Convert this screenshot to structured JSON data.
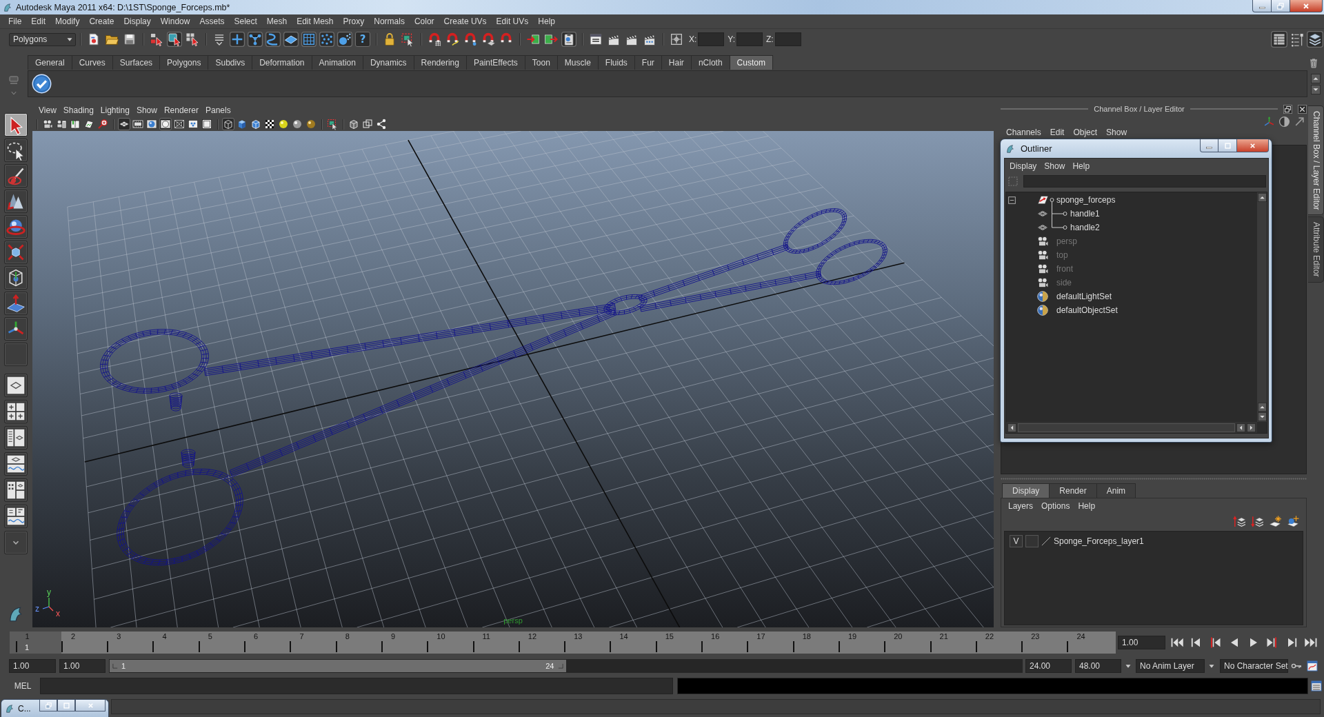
{
  "window": {
    "title": "Autodesk Maya 2011 x64: D:\\1ST\\Sponge_Forceps.mb*"
  },
  "menu_bar": [
    "File",
    "Edit",
    "Modify",
    "Create",
    "Display",
    "Window",
    "Assets",
    "Select",
    "Mesh",
    "Edit Mesh",
    "Proxy",
    "Normals",
    "Color",
    "Create UVs",
    "Edit UVs",
    "Help"
  ],
  "status_line": {
    "menu_set": "Polygons",
    "tool_groups": [
      [
        {
          "kind": "new",
          "on": false
        },
        {
          "kind": "open",
          "on": false
        },
        {
          "kind": "save",
          "on": false
        }
      ],
      [
        {
          "kind": "hierarchy",
          "on": false
        },
        {
          "kind": "object",
          "on": true
        },
        {
          "kind": "component",
          "on": false
        }
      ],
      [
        {
          "kind": "masks",
          "on": false
        },
        {
          "kind": "handles",
          "on": true
        },
        {
          "kind": "joints",
          "on": true
        },
        {
          "kind": "curves",
          "on": true
        },
        {
          "kind": "surfaces",
          "on": true
        },
        {
          "kind": "deformers",
          "on": true
        },
        {
          "kind": "dynamics",
          "on": true
        },
        {
          "kind": "rendering",
          "on": true
        },
        {
          "kind": "help",
          "label": "?",
          "on": true
        }
      ],
      [
        {
          "kind": "lock",
          "on": false
        },
        {
          "kind": "highlight",
          "on": false
        }
      ],
      [
        {
          "kind": "snapgrid",
          "on": false
        },
        {
          "kind": "snapcurve",
          "on": false
        },
        {
          "kind": "snappoint",
          "on": false
        },
        {
          "kind": "snapplane",
          "on": false
        },
        {
          "kind": "snaplive",
          "on": false
        }
      ],
      [
        {
          "kind": "inputs",
          "on": false
        },
        {
          "kind": "outputs",
          "on": false
        },
        {
          "kind": "history",
          "on": true
        }
      ],
      [
        {
          "kind": "renderview",
          "on": false
        },
        {
          "kind": "render",
          "on": false
        },
        {
          "kind": "ipr",
          "on": false
        },
        {
          "kind": "rendersettings",
          "on": false
        }
      ]
    ],
    "coordinate_labels": [
      "X:",
      "Y:",
      "Z:"
    ],
    "panel_toggles": [
      {
        "kind": "attributes",
        "on": true
      },
      {
        "kind": "toolsettings",
        "on": false
      },
      {
        "kind": "channels",
        "on": true
      }
    ]
  },
  "shelf": {
    "tabs": [
      {
        "label": "General",
        "selected": false
      },
      {
        "label": "Curves",
        "selected": false
      },
      {
        "label": "Surfaces",
        "selected": false
      },
      {
        "label": "Polygons",
        "selected": false
      },
      {
        "label": "Subdivs",
        "selected": false
      },
      {
        "label": "Deformation",
        "selected": false
      },
      {
        "label": "Animation",
        "selected": false
      },
      {
        "label": "Dynamics",
        "selected": false
      },
      {
        "label": "Rendering",
        "selected": false
      },
      {
        "label": "PaintEffects",
        "selected": false
      },
      {
        "label": "Toon",
        "selected": false
      },
      {
        "label": "Muscle",
        "selected": false
      },
      {
        "label": "Fluids",
        "selected": false
      },
      {
        "label": "Fur",
        "selected": false
      },
      {
        "label": "Hair",
        "selected": false
      },
      {
        "label": "nCloth",
        "selected": false
      },
      {
        "label": "Custom",
        "selected": true
      }
    ]
  },
  "toolbox": {
    "tools": [
      {
        "kind": "select",
        "selected": true
      },
      {
        "kind": "lasso",
        "selected": false
      },
      {
        "kind": "paint",
        "selected": false
      },
      {
        "kind": "move",
        "selected": false
      },
      {
        "kind": "rotate",
        "selected": false
      },
      {
        "kind": "scale",
        "selected": false
      },
      {
        "kind": "universal",
        "selected": false
      },
      {
        "kind": "softmod",
        "selected": false
      },
      {
        "kind": "manip",
        "selected": false
      },
      {
        "kind": "lasttool",
        "selected": false
      }
    ],
    "layouts": [
      {
        "kind": "single"
      },
      {
        "kind": "four"
      },
      {
        "kind": "outlinerpersp"
      },
      {
        "kind": "perspgraph"
      },
      {
        "kind": "hypershade"
      },
      {
        "kind": "hypergraph"
      }
    ]
  },
  "viewport": {
    "menu": [
      "View",
      "Shading",
      "Lighting",
      "Show",
      "Renderer",
      "Panels"
    ],
    "tool_groups": [
      [
        {
          "kind": "camera",
          "on": false
        },
        {
          "kind": "cameraattrs",
          "on": false
        },
        {
          "kind": "bookmark",
          "on": false
        },
        {
          "kind": "imageplane",
          "on": false
        },
        {
          "kind": "zoom",
          "on": false
        }
      ],
      [
        {
          "kind": "grid",
          "on": true
        },
        {
          "kind": "filmgate",
          "on": false
        },
        {
          "kind": "resgate",
          "on": false
        },
        {
          "kind": "gatemask",
          "on": true
        },
        {
          "kind": "fieldchart",
          "on": false
        },
        {
          "kind": "safeaction",
          "on": false
        },
        {
          "kind": "safetitle",
          "on": false
        }
      ],
      [
        {
          "kind": "wireframe",
          "on": true
        },
        {
          "kind": "smooth",
          "on": false
        },
        {
          "kind": "wireshaded",
          "on": false
        },
        {
          "kind": "textured",
          "on": false
        },
        {
          "kind": "defaultlight",
          "on": false
        },
        {
          "kind": "alllights",
          "on": false
        },
        {
          "kind": "shadows",
          "on": false
        }
      ],
      [
        {
          "kind": "isolate",
          "on": false
        }
      ],
      [
        {
          "kind": "xray",
          "on": false
        },
        {
          "kind": "xrayjoints",
          "on": false
        },
        {
          "kind": "share",
          "on": false
        }
      ]
    ],
    "camera_label": "persp",
    "axis_labels": [
      {
        "kind": "y",
        "label": "y"
      },
      {
        "kind": "z",
        "label": "z"
      },
      {
        "kind": "x",
        "label": "x"
      }
    ]
  },
  "channel_box": {
    "title": "Channel Box / Layer Editor",
    "menu": [
      "Channels",
      "Edit",
      "Object",
      "Show"
    ]
  },
  "outliner": {
    "title": "Outliner",
    "menu": [
      "Display",
      "Show",
      "Help"
    ],
    "items": [
      {
        "label": "sponge_forceps",
        "kind": "transform",
        "dimmed": false,
        "expanded": true,
        "children": [
          {
            "label": "handle1",
            "kind": "mesh",
            "dimmed": false
          },
          {
            "label": "handle2",
            "kind": "mesh",
            "dimmed": false
          }
        ]
      },
      {
        "label": "persp",
        "kind": "camera",
        "dimmed": true
      },
      {
        "label": "top",
        "kind": "camera",
        "dimmed": true
      },
      {
        "label": "front",
        "kind": "camera",
        "dimmed": true
      },
      {
        "label": "side",
        "kind": "camera",
        "dimmed": true
      },
      {
        "label": "defaultLightSet",
        "kind": "set",
        "dimmed": false
      },
      {
        "label": "defaultObjectSet",
        "kind": "set",
        "dimmed": false
      }
    ]
  },
  "layer_editor": {
    "tabs": [
      {
        "label": "Display",
        "selected": true
      },
      {
        "label": "Render",
        "selected": false
      },
      {
        "label": "Anim",
        "selected": false
      }
    ],
    "menu": [
      "Layers",
      "Options",
      "Help"
    ],
    "layers": [
      {
        "visibility": "V",
        "name": "Sponge_Forceps_layer1"
      }
    ]
  },
  "side_tabs": [
    {
      "label": "Channel Box / Layer Editor",
      "selected": true
    },
    {
      "label": "Attribute Editor",
      "selected": false
    }
  ],
  "timeline": {
    "frames": [
      {
        "label": "1",
        "selected": true
      },
      {
        "label": "2",
        "selected": false
      },
      {
        "label": "3",
        "selected": false
      },
      {
        "label": "4",
        "selected": false
      },
      {
        "label": "5",
        "selected": false
      },
      {
        "label": "6",
        "selected": false
      },
      {
        "label": "7",
        "selected": false
      },
      {
        "label": "8",
        "selected": false
      },
      {
        "label": "9",
        "selected": false
      },
      {
        "label": "10",
        "selected": false
      },
      {
        "label": "11",
        "selected": false
      },
      {
        "label": "12",
        "selected": false
      },
      {
        "label": "13",
        "selected": false
      },
      {
        "label": "14",
        "selected": false
      },
      {
        "label": "15",
        "selected": false
      },
      {
        "label": "16",
        "selected": false
      },
      {
        "label": "17",
        "selected": false
      },
      {
        "label": "18",
        "selected": false
      },
      {
        "label": "19",
        "selected": false
      },
      {
        "label": "20",
        "selected": false
      },
      {
        "label": "21",
        "selected": false
      },
      {
        "label": "22",
        "selected": false
      },
      {
        "label": "23",
        "selected": false
      },
      {
        "label": "24",
        "selected": false
      }
    ],
    "current_frame": "1",
    "current_time": "1.00"
  },
  "range_slider": {
    "start_time": "1.00",
    "playback_start": "1.00",
    "range_start": "1",
    "range_end": "24",
    "level": 0.5,
    "playback_end": "24.00",
    "end_time": "48.00",
    "anim_layer": "No Anim Layer",
    "character_set": "No Character Set"
  },
  "command_line": {
    "language": "MEL"
  },
  "minimized_window": {
    "title": "C..."
  }
}
